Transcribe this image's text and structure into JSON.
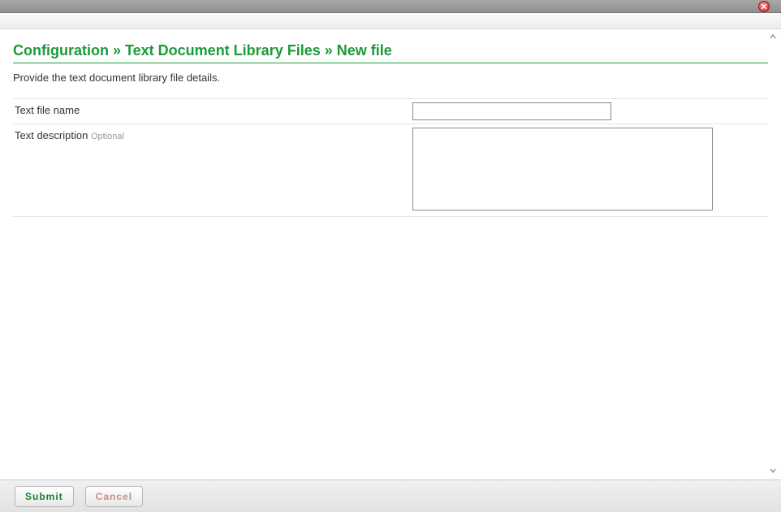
{
  "window": {
    "close_label": "Close"
  },
  "breadcrumb": {
    "part1": "Configuration",
    "sep": " » ",
    "part2": "Text Document Library Files",
    "part3": "New file"
  },
  "instructions": "Provide the text document library file details.",
  "form": {
    "text_file_name": {
      "label": "Text file name",
      "value": ""
    },
    "text_description": {
      "label": "Text description",
      "optional_label": "Optional",
      "value": ""
    }
  },
  "footer": {
    "submit_label": "Submit",
    "cancel_label": "Cancel"
  }
}
